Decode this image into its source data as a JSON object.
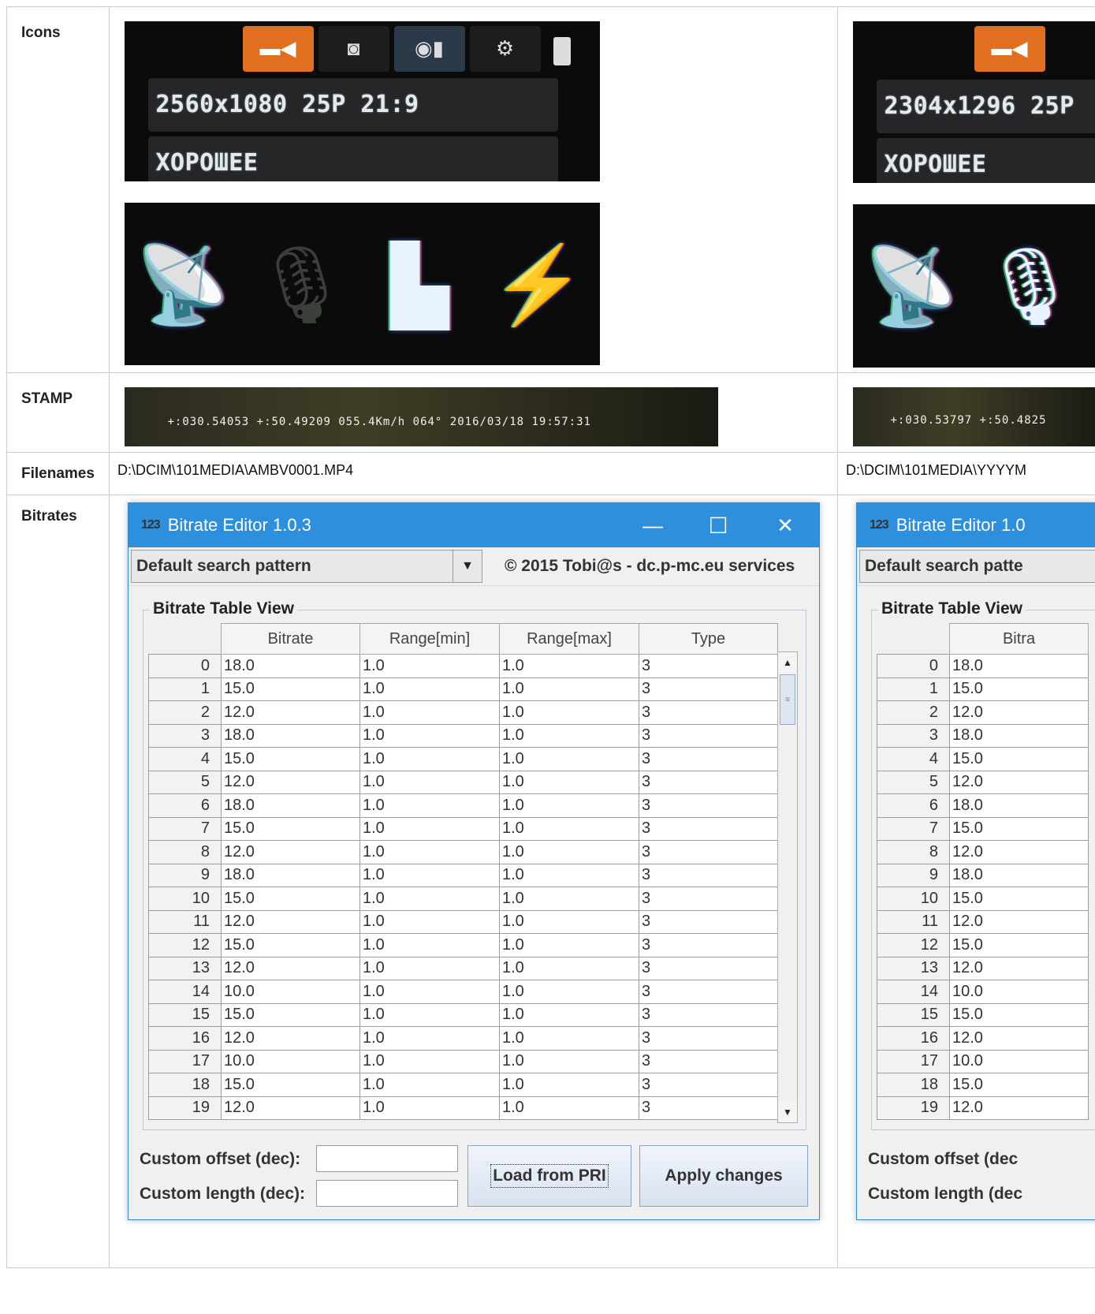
{
  "rows": {
    "icons": "Icons",
    "stamp": "STAMP",
    "filenames": "Filenames",
    "bitrates": "Bitrates"
  },
  "col1": {
    "resolution": "2560x1080 25P 21:9",
    "quality": "ХОРОШЕЕ",
    "stamp_text": "+:030.54053 +:50.49209 055.4Km/h 064°  2016/03/18 19:57:31",
    "filename": "D:\\DCIM\\101MEDIA\\AMBV0001.MP4"
  },
  "col2": {
    "resolution": "2304x1296 25P",
    "quality": "ХОРОШЕЕ",
    "stamp_text": "+:030.53797 +:50.4825",
    "filename": "D:\\DCIM\\101MEDIA\\YYYYM"
  },
  "camera_tabs": [
    "video-camera-icon",
    "photo-camera-icon",
    "playback-icon",
    "settings-gear-icon"
  ],
  "status_icons": [
    "gps-satellite-icon",
    "microphone-icon",
    "sd-card-icon",
    "battery-charging-icon"
  ],
  "editor": {
    "app_icon": "123",
    "title": "Bitrate Editor 1.0.3",
    "title_short": "Bitrate Editor 1.0",
    "minimize": "—",
    "maximize": "☐",
    "close": "✕",
    "search_pattern": "Default search pattern",
    "search_pattern_short": "Default search patte",
    "copyright": "© 2015 Tobi@s - dc.p-mc.eu services",
    "group_title": "Bitrate Table View",
    "group_title_short": "Bitrate Table View",
    "columns": [
      "Bitrate",
      "Range[min]",
      "Range[max]",
      "Type"
    ],
    "column_short": "Bitra",
    "rows": [
      [
        "0",
        "18.0",
        "1.0",
        "1.0",
        "3"
      ],
      [
        "1",
        "15.0",
        "1.0",
        "1.0",
        "3"
      ],
      [
        "2",
        "12.0",
        "1.0",
        "1.0",
        "3"
      ],
      [
        "3",
        "18.0",
        "1.0",
        "1.0",
        "3"
      ],
      [
        "4",
        "15.0",
        "1.0",
        "1.0",
        "3"
      ],
      [
        "5",
        "12.0",
        "1.0",
        "1.0",
        "3"
      ],
      [
        "6",
        "18.0",
        "1.0",
        "1.0",
        "3"
      ],
      [
        "7",
        "15.0",
        "1.0",
        "1.0",
        "3"
      ],
      [
        "8",
        "12.0",
        "1.0",
        "1.0",
        "3"
      ],
      [
        "9",
        "18.0",
        "1.0",
        "1.0",
        "3"
      ],
      [
        "10",
        "15.0",
        "1.0",
        "1.0",
        "3"
      ],
      [
        "11",
        "12.0",
        "1.0",
        "1.0",
        "3"
      ],
      [
        "12",
        "15.0",
        "1.0",
        "1.0",
        "3"
      ],
      [
        "13",
        "12.0",
        "1.0",
        "1.0",
        "3"
      ],
      [
        "14",
        "10.0",
        "1.0",
        "1.0",
        "3"
      ],
      [
        "15",
        "15.0",
        "1.0",
        "1.0",
        "3"
      ],
      [
        "16",
        "12.0",
        "1.0",
        "1.0",
        "3"
      ],
      [
        "17",
        "10.0",
        "1.0",
        "1.0",
        "3"
      ],
      [
        "18",
        "15.0",
        "1.0",
        "1.0",
        "3"
      ],
      [
        "19",
        "12.0",
        "1.0",
        "1.0",
        "3"
      ]
    ],
    "custom_offset_label": "Custom offset (dec):",
    "custom_offset_short": "Custom offset (dec",
    "custom_length_label": "Custom length (dec):",
    "custom_length_short": "Custom length (dec",
    "custom_offset_value": "",
    "custom_length_value": "",
    "load_button": "Load from PRI",
    "apply_button": "Apply changes"
  }
}
